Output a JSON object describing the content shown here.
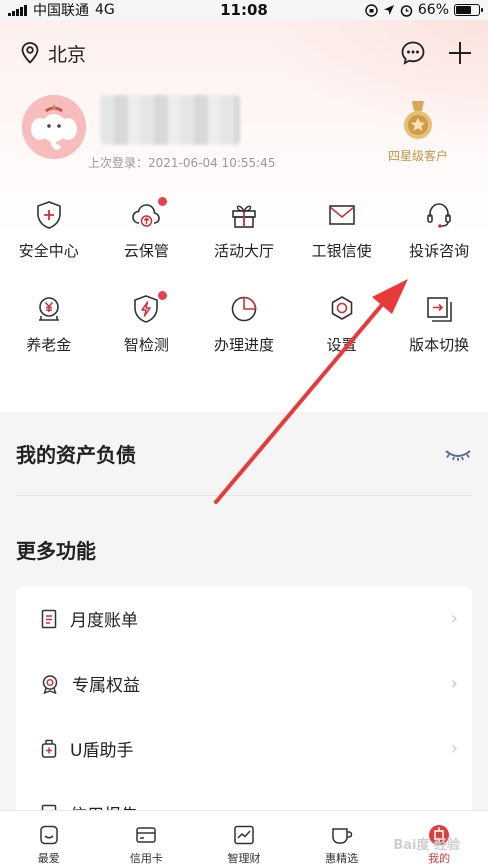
{
  "status_bar": {
    "carrier": "中国联通",
    "network": "4G",
    "time": "11:08",
    "battery": "66%",
    "battery_level": 0.66
  },
  "header": {
    "location": "北京"
  },
  "profile": {
    "last_login": "上次登录：2021-06-04 10:55:45",
    "level_badge": "四星级客户"
  },
  "grid": {
    "row1": [
      {
        "label": "安全中心",
        "icon": "shield-plus-icon"
      },
      {
        "label": "云保管",
        "icon": "cloud-upload-icon"
      },
      {
        "label": "活动大厅",
        "icon": "gift-icon"
      },
      {
        "label": "工银信使",
        "icon": "envelope-icon"
      },
      {
        "label": "投诉咨询",
        "icon": "headset-icon"
      }
    ],
    "row2": [
      {
        "label": "养老金",
        "icon": "pension-yen-icon"
      },
      {
        "label": "智检测",
        "icon": "shield-bolt-icon"
      },
      {
        "label": "办理进度",
        "icon": "pie-progress-icon"
      },
      {
        "label": "设置",
        "icon": "gear-icon"
      },
      {
        "label": "版本切换",
        "icon": "switch-version-icon"
      }
    ]
  },
  "assets": {
    "title": "我的资产负债"
  },
  "more": {
    "title": "更多功能",
    "items": [
      {
        "label": "月度账单",
        "icon": "bill-icon"
      },
      {
        "label": "专属权益",
        "icon": "medal-icon"
      },
      {
        "label": "U盾助手",
        "icon": "usb-key-icon"
      },
      {
        "label": "信用报告",
        "icon": "report-icon"
      }
    ]
  },
  "tabbar": {
    "tabs": [
      {
        "label": "最爱",
        "icon": "smile-box-icon"
      },
      {
        "label": "信用卡",
        "icon": "credit-card-icon"
      },
      {
        "label": "智理财",
        "icon": "chart-line-icon"
      },
      {
        "label": "惠精选",
        "icon": "cup-icon"
      },
      {
        "label": "我的",
        "icon": "icbc-logo-icon"
      }
    ]
  },
  "watermark": "Bai度 经验",
  "colors": {
    "accent": "#e13c3c",
    "badge_gold": "#c79545",
    "icon_red": "#c9303a"
  }
}
